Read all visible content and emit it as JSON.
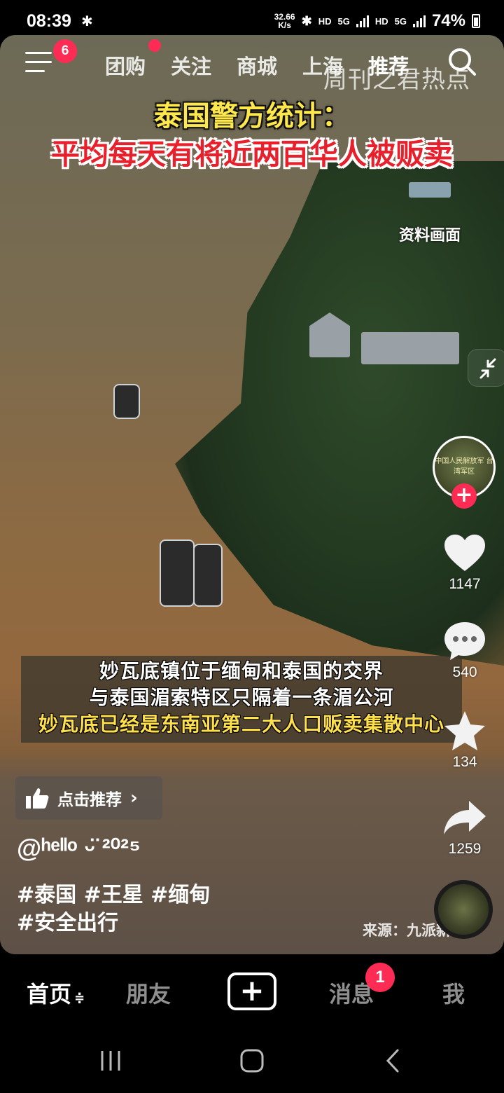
{
  "status_bar": {
    "time": "08:39",
    "net_speed_value": "32.66",
    "net_speed_unit": "K/s",
    "hd1": "HD",
    "net1": "5G",
    "hd2": "HD",
    "net2": "5G",
    "battery": "74%"
  },
  "top_nav": {
    "menu_badge": "6",
    "tabs": [
      "团购",
      "关注",
      "商城",
      "上海",
      "推荐"
    ],
    "watermark": "周刊之君热点"
  },
  "video": {
    "headline_line1": "泰国警方统计：",
    "headline_line2": "平均每天有将近两百华人被贩卖",
    "reference_label": "资料画面",
    "subtitle_line1": "妙瓦底镇位于缅甸和泰国的交界",
    "subtitle_line2": "与泰国湄索特区只隔着一条湄公河",
    "subtitle_line3": "妙瓦底已经是东南亚第二大人口贩卖集散中心",
    "source": "来源：九派新"
  },
  "avatar_text": "中国人民解放军 台湾军区",
  "actions": {
    "likes": "1147",
    "comments": "540",
    "favorites": "134",
    "shares": "1259"
  },
  "post": {
    "recommend_label": "点击推荐",
    "author": "@ʰᵉˡˡᵒ ᵕ̈ ²⁰²⁵",
    "hashtags_line1": "#泰国 #王星 #缅甸",
    "hashtags_line2": "#安全出行"
  },
  "bottom_tabs": {
    "home": "首页",
    "friends": "朋友",
    "add": "+",
    "messages": "消息",
    "messages_badge": "1",
    "me": "我"
  },
  "colors": {
    "accent": "#fe2c55",
    "headline_yellow": "#ffe84c",
    "headline_red": "#e8202c",
    "subtitle_yellow": "#ffe04a"
  },
  "icons": [
    "menu-icon",
    "search-icon",
    "collapse-icon",
    "heart-icon",
    "comment-icon",
    "star-icon",
    "share-icon",
    "thumbs-up-icon",
    "chevron-right-icon"
  ]
}
